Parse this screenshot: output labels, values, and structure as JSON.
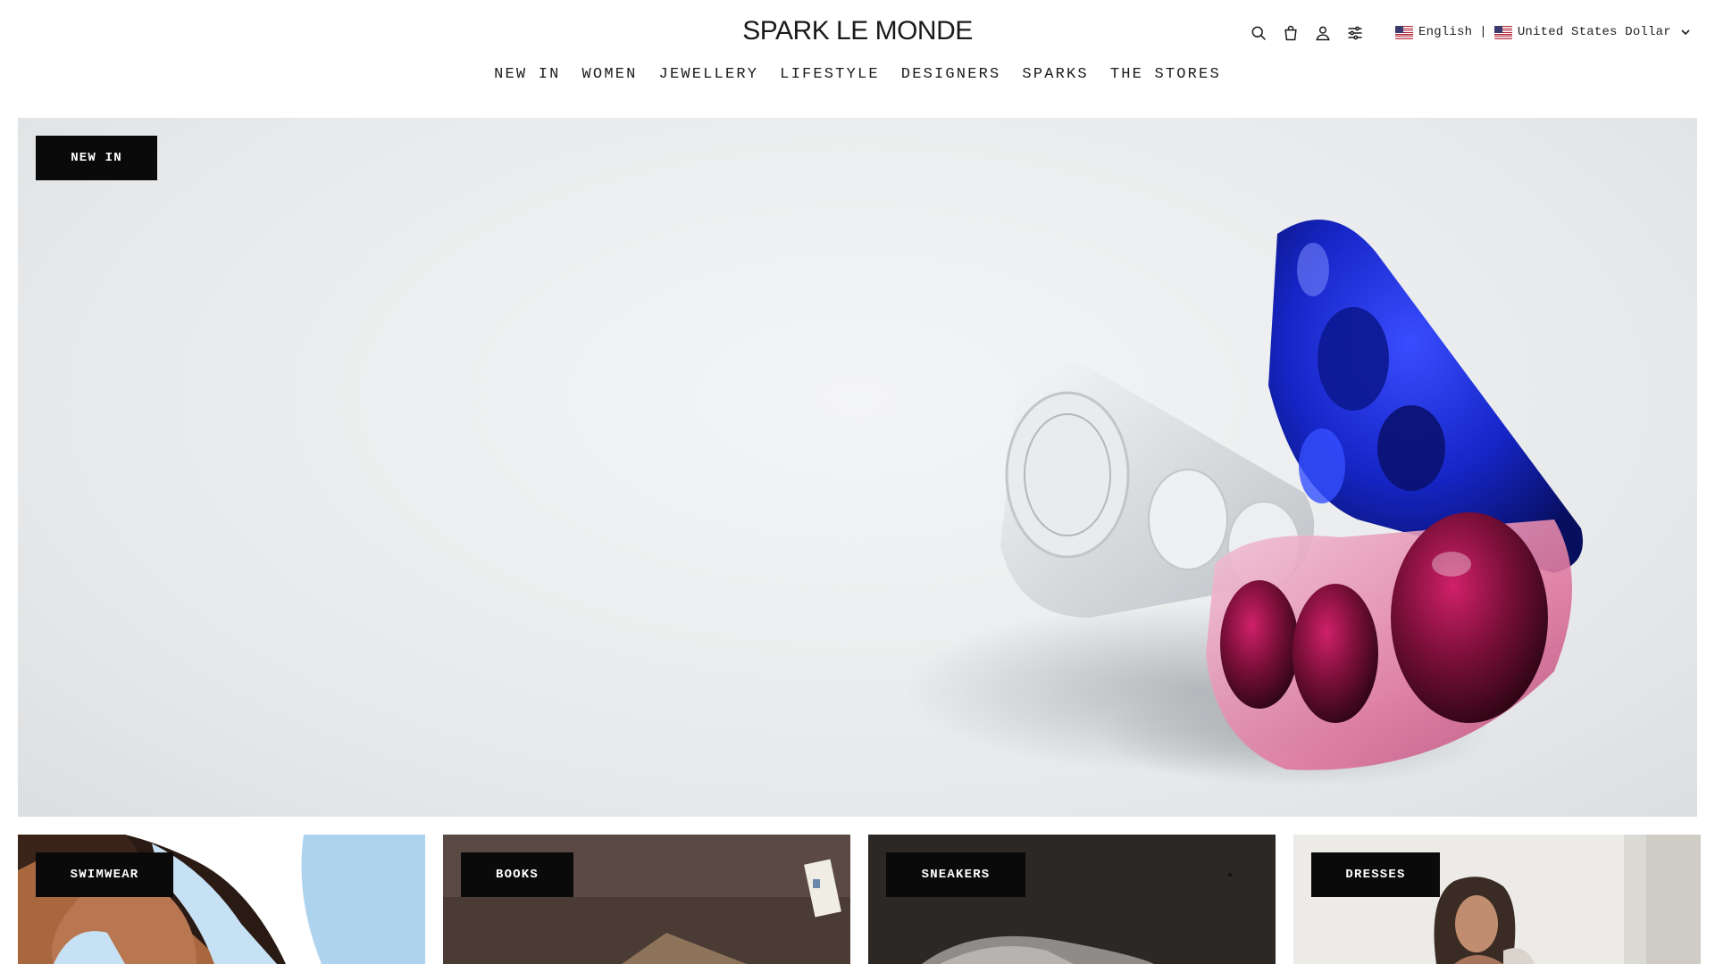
{
  "brand": {
    "logo_text": "SPARK LE MONDE"
  },
  "header": {
    "icons": [
      "search-icon",
      "bag-icon",
      "account-icon",
      "filter-icon"
    ],
    "language": "English",
    "separator": "|",
    "currency": "United States Dollar"
  },
  "nav": {
    "items": [
      {
        "label": "NEW IN"
      },
      {
        "label": "WOMEN"
      },
      {
        "label": "JEWELLERY"
      },
      {
        "label": "LIFESTYLE"
      },
      {
        "label": "DESIGNERS"
      },
      {
        "label": "SPARKS"
      },
      {
        "label": "THE STORES"
      }
    ]
  },
  "hero": {
    "badge": "NEW IN"
  },
  "tiles": [
    {
      "label": "SWIMWEAR"
    },
    {
      "label": "BOOKS"
    },
    {
      "label": "SNEAKERS"
    },
    {
      "label": "DRESSES"
    }
  ],
  "colors": {
    "badge_bg": "#0a0a0a",
    "badge_text": "#ffffff",
    "accent_blue": "#1f2fd6",
    "accent_pink": "#c01a5a"
  }
}
